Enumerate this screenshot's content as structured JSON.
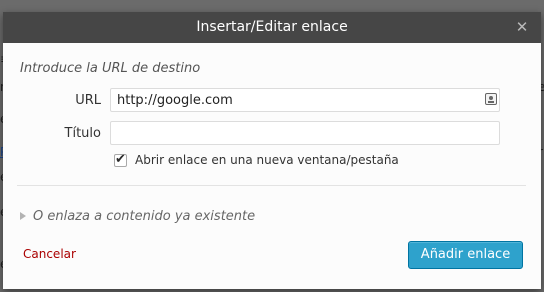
{
  "dialog": {
    "title": "Insertar/Editar enlace",
    "close_glyph": "✕",
    "section_label": "Introduce la URL de destino",
    "url": {
      "label": "URL",
      "value": "http://google.com"
    },
    "title_field": {
      "label": "Título",
      "value": ""
    },
    "new_tab_checkbox": {
      "label": "Abrir enlace en una nueva ventana/pestaña",
      "checked": true
    },
    "existing_content_toggle": "O enlaza a contenido ya existente",
    "cancel_label": "Cancelar",
    "submit_label": "Añadir enlace"
  },
  "colors": {
    "titlebar": "#464646",
    "primary_button": "#2ea2cc",
    "cancel_link": "#aa0000"
  }
}
